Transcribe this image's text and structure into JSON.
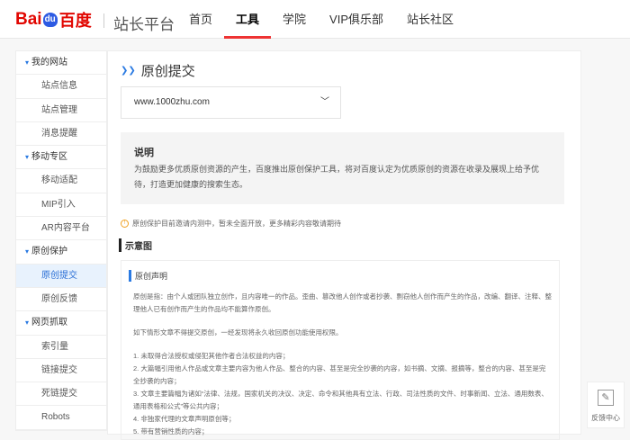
{
  "header": {
    "logo_text": "Bai",
    "logo_du": "du",
    "logo_cn": "百度",
    "site_name": "站长平台",
    "nav": [
      "首页",
      "工具",
      "学院",
      "VIP俱乐部",
      "站长社区"
    ],
    "active_nav": 1
  },
  "sidebar": [
    {
      "label": "我的网站",
      "type": "grp"
    },
    {
      "label": "站点信息",
      "type": "sub"
    },
    {
      "label": "站点管理",
      "type": "sub"
    },
    {
      "label": "消息提醒",
      "type": "sub"
    },
    {
      "label": "移动专区",
      "type": "grp"
    },
    {
      "label": "移动适配",
      "type": "sub"
    },
    {
      "label": "MIP引入",
      "type": "sub"
    },
    {
      "label": "AR内容平台",
      "type": "sub"
    },
    {
      "label": "原创保护",
      "type": "grp"
    },
    {
      "label": "原创提交",
      "type": "sub",
      "active": true
    },
    {
      "label": "原创反馈",
      "type": "sub"
    },
    {
      "label": "网页抓取",
      "type": "grp"
    },
    {
      "label": "索引量",
      "type": "sub"
    },
    {
      "label": "链接提交",
      "type": "sub"
    },
    {
      "label": "死链提交",
      "type": "sub"
    },
    {
      "label": "Robots",
      "type": "sub"
    }
  ],
  "main": {
    "title": "原创提交",
    "site_select": "www.1000zhu.com",
    "desc_title": "说明",
    "desc_text": "为鼓励更多优质原创资源的产生，百度推出原创保护工具，将对百度认定为优质原创的资源在收录及展现上给予优待，打造更加健康的搜索生态。",
    "notice": "原创保护目前邀请内测中，暂未全面开放，更多精彩内容敬请期待",
    "example_heading": "示意图",
    "example": {
      "title": "原创声明",
      "p1": "原创是指：由个人或团队独立创作，且内容唯一的作品。歪曲、篡改他人创作或者抄袭、剽窃他人创作而产生的作品，改编、翻译、注释、整理他人已有创作而产生的作品均不能算作原创。",
      "p2": "如下情形文章不得提交原创，一经发现将永久收回原创功能使用权限。",
      "items": [
        "1. 未取得合法授权或侵犯其他作者合法权益的内容；",
        "2. 大篇幅引用他人作品或文章主要内容为他人作品、整合的内容、甚至是完全抄袭的内容，如书摘、文摘、报摘等，整合的内容、甚至是完全抄袭的内容；",
        "3. 文章主要篇幅为诸如“法律、法规，国家机关的决议、决定、命令和其他具有立法、行政、司法性质的文件、时事新闻、立法、通用数表、通用表格和公式”等公共内容；",
        "4. 非独家代理的文章声明原创等；",
        "5. 带有营销性质的内容；"
      ]
    }
  },
  "feedback": {
    "label": "反馈中心"
  }
}
